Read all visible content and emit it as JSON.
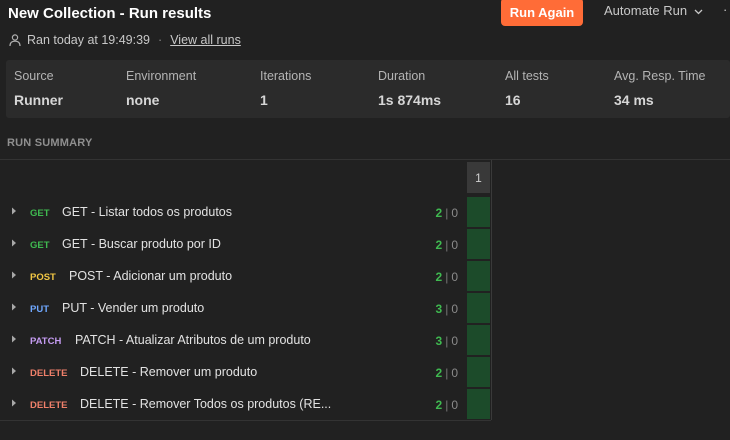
{
  "header": {
    "title": "New Collection - Run results",
    "run_again_label": "Run Again",
    "automate_label": "Automate Run",
    "more_label": "·"
  },
  "meta": {
    "ran_text": "Ran today at 19:49:39",
    "separator": "·",
    "view_all_label": "View all runs"
  },
  "stats": [
    {
      "label": "Source",
      "value": "Runner"
    },
    {
      "label": "Environment",
      "value": "none"
    },
    {
      "label": "Iterations",
      "value": "1"
    },
    {
      "label": "Duration",
      "value": "1s 874ms"
    },
    {
      "label": "All tests",
      "value": "16"
    },
    {
      "label": "Avg. Resp. Time",
      "value": "34 ms"
    }
  ],
  "summary": {
    "title": "RUN SUMMARY",
    "iteration_label": "1",
    "separator": "|"
  },
  "requests": [
    {
      "method": "GET",
      "method_color": "#3fb950",
      "name": "GET - Listar todos os produtos",
      "passed": "2",
      "failed": "0"
    },
    {
      "method": "GET",
      "method_color": "#3fb950",
      "name": "GET - Buscar produto por ID",
      "passed": "2",
      "failed": "0"
    },
    {
      "method": "POST",
      "method_color": "#f2c744",
      "name": "POST - Adicionar um produto",
      "passed": "2",
      "failed": "0"
    },
    {
      "method": "PUT",
      "method_color": "#6fa8ff",
      "name": "PUT - Vender um produto",
      "passed": "3",
      "failed": "0"
    },
    {
      "method": "PATCH",
      "method_color": "#c59cf2",
      "name": "PATCH - Atualizar Atributos de um produto",
      "passed": "3",
      "failed": "0"
    },
    {
      "method": "DELETE",
      "method_color": "#f0806a",
      "name": "DELETE - Remover um produto",
      "passed": "2",
      "failed": "0"
    },
    {
      "method": "DELETE",
      "method_color": "#f0806a",
      "name": "DELETE - Remover Todos os produtos (RE...",
      "passed": "2",
      "failed": "0"
    }
  ],
  "colors": {
    "accent": "#ff6c37",
    "pass": "#3fb950",
    "pass_cell": "#1c4b2a"
  }
}
